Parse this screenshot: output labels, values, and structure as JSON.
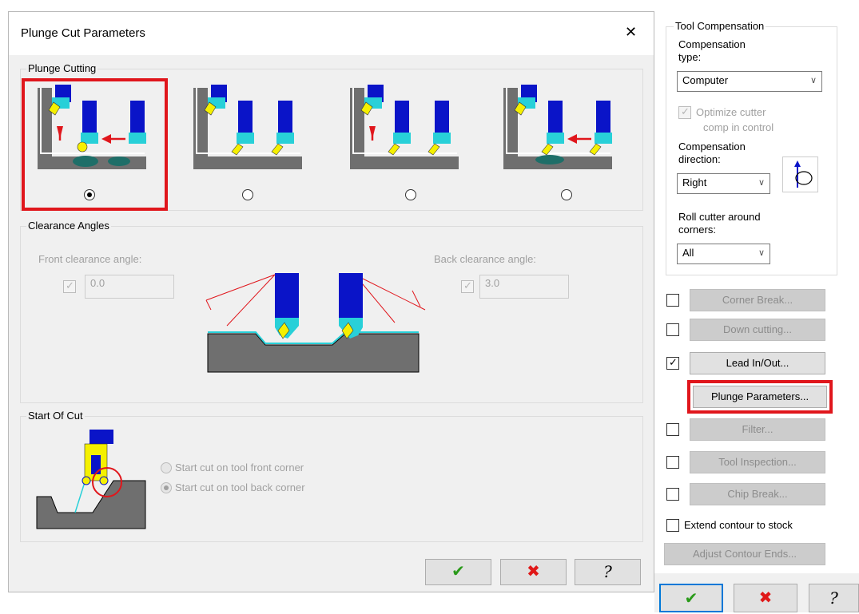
{
  "dialog": {
    "title": "Plunge Cut Parameters",
    "close_glyph": "✕",
    "plunge_group": "Plunge Cutting",
    "plunge_options_selected": 0,
    "clearance_group": "Clearance Angles",
    "front_label": "Front clearance angle:",
    "front_value": "0.0",
    "back_label": "Back clearance angle:",
    "back_value": "3.0",
    "start_group": "Start Of Cut",
    "start_front": "Start cut on tool front corner",
    "start_back": "Start cut on tool back corner",
    "ok_glyph": "✔",
    "cancel_glyph": "✖",
    "help_glyph": "?"
  },
  "tool_comp": {
    "group": "Tool Compensation",
    "comp_type_label": "Compensation type:",
    "comp_type_value": "Computer",
    "optimize_label_1": "Optimize cutter",
    "optimize_label_2": "comp in control",
    "comp_dir_label": "Compensation direction:",
    "comp_dir_value": "Right",
    "roll_label": "Roll cutter around corners:",
    "roll_value": "All"
  },
  "side_buttons": {
    "corner_break": "Corner Break...",
    "down_cutting": "Down cutting...",
    "lead_in_out": "Lead In/Out...",
    "plunge_parameters": "Plunge Parameters...",
    "filter": "Filter...",
    "tool_inspection": "Tool Inspection...",
    "chip_break": "Chip Break...",
    "extend_contour": "Extend contour to stock",
    "adjust_contour": "Adjust Contour Ends..."
  },
  "colors": {
    "accent_red": "#e0161c",
    "tool_blue": "#0a14c8",
    "insert_yellow": "#f5f000",
    "holder_cyan": "#28d0d8",
    "stock_gray": "#6f6f6f",
    "ok_green": "#2a9a1a",
    "cancel_red": "#e01818"
  }
}
